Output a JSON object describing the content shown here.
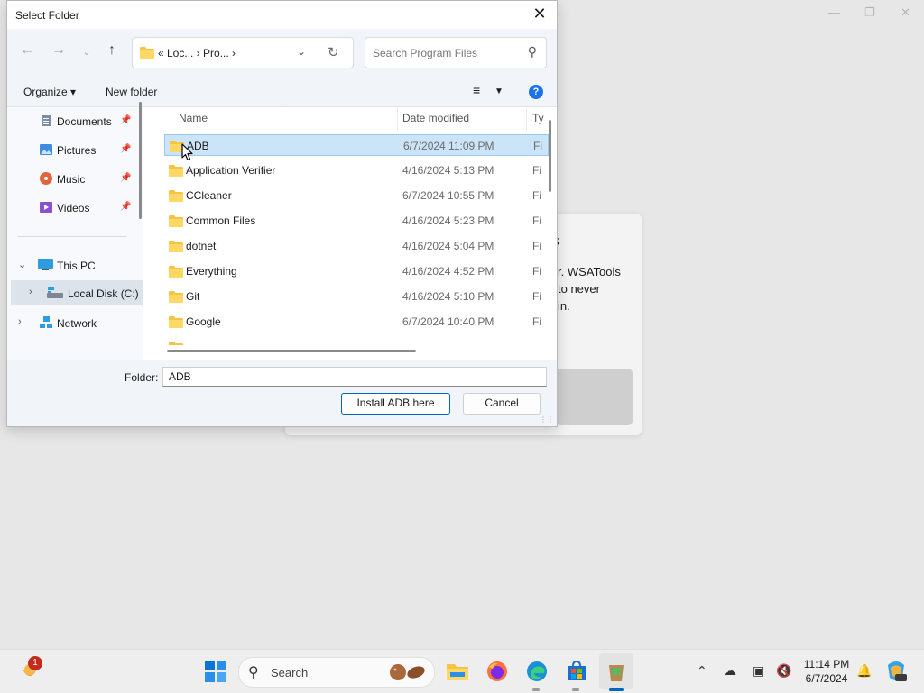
{
  "dialog": {
    "title": "Select Folder",
    "address": {
      "path": "«  Loc...  ›  Pro...  ›"
    },
    "search": {
      "placeholder": "Search Program Files"
    },
    "commands": {
      "organize": "Organize ▾",
      "new_folder": "New folder",
      "help": "?"
    },
    "nav": [
      {
        "label": "Documents",
        "icon": "documents-icon",
        "pinned": true
      },
      {
        "label": "Pictures",
        "icon": "pictures-icon",
        "pinned": true
      },
      {
        "label": "Music",
        "icon": "music-icon",
        "pinned": true
      },
      {
        "label": "Videos",
        "icon": "videos-icon",
        "pinned": true
      },
      {
        "label": "This PC",
        "icon": "computer-icon",
        "expanded": true
      },
      {
        "label": "Local Disk (C:)",
        "icon": "drive-icon",
        "selected": true
      },
      {
        "label": "Network",
        "icon": "network-icon"
      }
    ],
    "columns": {
      "name": "Name",
      "date": "Date modified",
      "type": "Ty"
    },
    "files": [
      {
        "name": "ADB",
        "date": "6/7/2024 11:09 PM",
        "type": "Fi",
        "selected": true
      },
      {
        "name": "Application Verifier",
        "date": "4/16/2024 5:13 PM",
        "type": "Fi"
      },
      {
        "name": "CCleaner",
        "date": "6/7/2024 10:55 PM",
        "type": "Fi"
      },
      {
        "name": "Common Files",
        "date": "4/16/2024 5:23 PM",
        "type": "Fi"
      },
      {
        "name": "dotnet",
        "date": "4/16/2024 5:04 PM",
        "type": "Fi"
      },
      {
        "name": "Everything",
        "date": "4/16/2024 4:52 PM",
        "type": "Fi"
      },
      {
        "name": "Git",
        "date": "4/16/2024 5:10 PM",
        "type": "Fi"
      },
      {
        "name": "Google",
        "date": "6/7/2024 10:40 PM",
        "type": "Fi"
      }
    ],
    "folder_label": "Folder:",
    "folder_value": "ADB",
    "buttons": {
      "primary": "Install ADB here",
      "cancel": "Cancel"
    }
  },
  "background": {
    "dialog_text_lines": [
      "r. WSATools",
      "to never",
      "in."
    ],
    "dialog_partial_char": "s"
  },
  "taskbar": {
    "search_label": "Search",
    "notification_count": "1",
    "time": "11:14 PM",
    "date": "6/7/2024"
  },
  "colors": {
    "accent": "#0067c0",
    "selection": "#cce4f7",
    "folder": "#f6c445"
  }
}
